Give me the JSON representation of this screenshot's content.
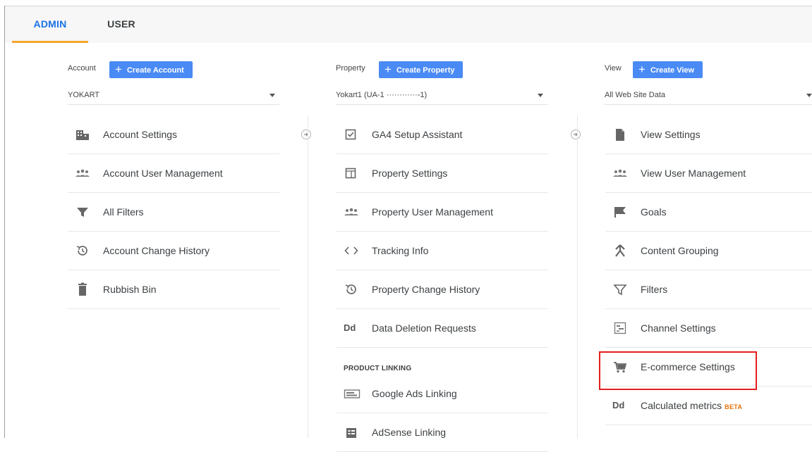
{
  "tabs": [
    {
      "label": "ADMIN",
      "active": true
    },
    {
      "label": "USER",
      "active": false
    }
  ],
  "account": {
    "label": "Account",
    "create_label": "Create Account",
    "selected": "YOKART",
    "items": [
      {
        "label": "Account Settings",
        "icon": "building-icon"
      },
      {
        "label": "Account User Management",
        "icon": "people-icon"
      },
      {
        "label": "All Filters",
        "icon": "filter-icon"
      },
      {
        "label": "Account Change History",
        "icon": "history-icon"
      },
      {
        "label": "Rubbish Bin",
        "icon": "trash-icon"
      }
    ]
  },
  "property": {
    "label": "Property",
    "create_label": "Create Property",
    "selected": "Yokart1 (UA-1 ············-1)",
    "items": [
      {
        "label": "GA4 Setup Assistant",
        "icon": "checkbox-icon"
      },
      {
        "label": "Property Settings",
        "icon": "window-icon"
      },
      {
        "label": "Property User Management",
        "icon": "people-icon"
      },
      {
        "label": "Tracking Info",
        "icon": "code-icon"
      },
      {
        "label": "Property Change History",
        "icon": "history-icon"
      },
      {
        "label": "Data Deletion Requests",
        "icon": "dd-icon",
        "glyph": "Dd"
      }
    ],
    "section_heading": "PRODUCT LINKING",
    "linking_items": [
      {
        "label": "Google Ads Linking",
        "icon": "ads-icon"
      },
      {
        "label": "AdSense Linking",
        "icon": "adsense-icon"
      }
    ]
  },
  "view": {
    "label": "View",
    "create_label": "Create View",
    "selected": "All Web Site Data",
    "items": [
      {
        "label": "View Settings",
        "icon": "document-icon"
      },
      {
        "label": "View User Management",
        "icon": "people-icon"
      },
      {
        "label": "Goals",
        "icon": "flag-icon"
      },
      {
        "label": "Content Grouping",
        "icon": "grouping-icon"
      },
      {
        "label": "Filters",
        "icon": "filter-outline-icon"
      },
      {
        "label": "Channel Settings",
        "icon": "channel-icon"
      },
      {
        "label": "E-commerce Settings",
        "icon": "cart-icon",
        "highlighted": true
      },
      {
        "label": "Calculated metrics",
        "icon": "dd-icon",
        "glyph": "Dd",
        "badge": "BETA"
      }
    ]
  },
  "colors": {
    "accent": "#1a73e8",
    "button": "#4a8af4",
    "tab_underline": "#f4a62a",
    "highlight": "#e41e1e",
    "beta": "#e8710a"
  }
}
